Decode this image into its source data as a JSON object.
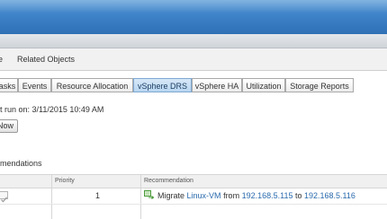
{
  "object_tabs": [
    "e",
    "Related Objects"
  ],
  "sub_tabs": [
    {
      "label": "asks",
      "active": false
    },
    {
      "label": "Events",
      "active": false
    },
    {
      "label": "Resource Allocation",
      "active": false
    },
    {
      "label": "vSphere DRS",
      "active": true
    },
    {
      "label": "vSphere HA",
      "active": false
    },
    {
      "label": "Utilization",
      "active": false
    },
    {
      "label": "Storage Reports",
      "active": false
    }
  ],
  "drs": {
    "last_run": "t run on: 3/11/2015 10:49 AM",
    "run_now_label": "Now",
    "section_title": "mendations"
  },
  "table": {
    "columns": [
      "",
      "Priority",
      "Recommendation"
    ],
    "rows": [
      {
        "checked": true,
        "priority": "1",
        "action": "Migrate",
        "vm": "Linux-VM",
        "from_text": "from",
        "source_host": "192.168.5.115",
        "to_text": "to",
        "target_host": "192.168.5.116"
      }
    ]
  },
  "colors": {
    "header_blue": "#3e82c8",
    "active_tab": "#b9d6f1",
    "link": "#2a6aad",
    "checkmark": "#9a9a9a",
    "migrate_icon": "#4a9a3a"
  }
}
